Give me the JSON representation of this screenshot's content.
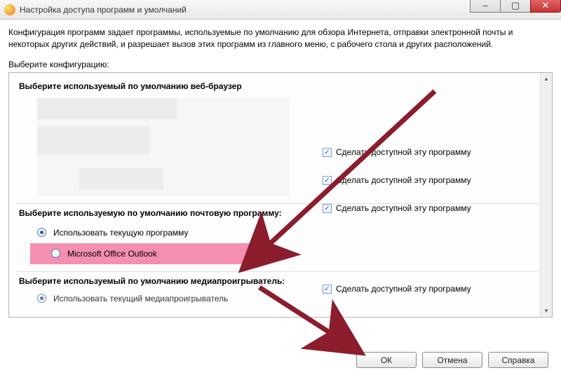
{
  "window": {
    "title": "Настройка доступа программ и умолчаний",
    "minimize": "–",
    "maximize": "▢",
    "close": "✕"
  },
  "description": "Конфигурация программ задает программы, используемые по умолчанию для обзора Интернета, отправки электронной почты и некоторых других действий, и разрешает вызов этих программ из главного меню, с рабочего стола и других расположений.",
  "choose_label": "Выберите конфигурацию:",
  "sections": {
    "browser_heading": "Выберите используемый по умолчанию веб-браузер",
    "mail_heading": "Выберите используемую по умолчанию почтовую программу:",
    "media_heading": "Выберите используемый по умолчанию медиапроигрыватель:"
  },
  "enable_label": "Сделать доступной эту программу",
  "mail": {
    "use_current": "Использовать текущую программу",
    "outlook": "Microsoft Office Outlook"
  },
  "media_partial": "Использовать текущий медиапроигрыватель",
  "buttons": {
    "ok": "ОК",
    "cancel": "Отмена",
    "help": "Справка"
  },
  "checkmark": "✓",
  "scroll_up": "▴",
  "scroll_down": "▾"
}
